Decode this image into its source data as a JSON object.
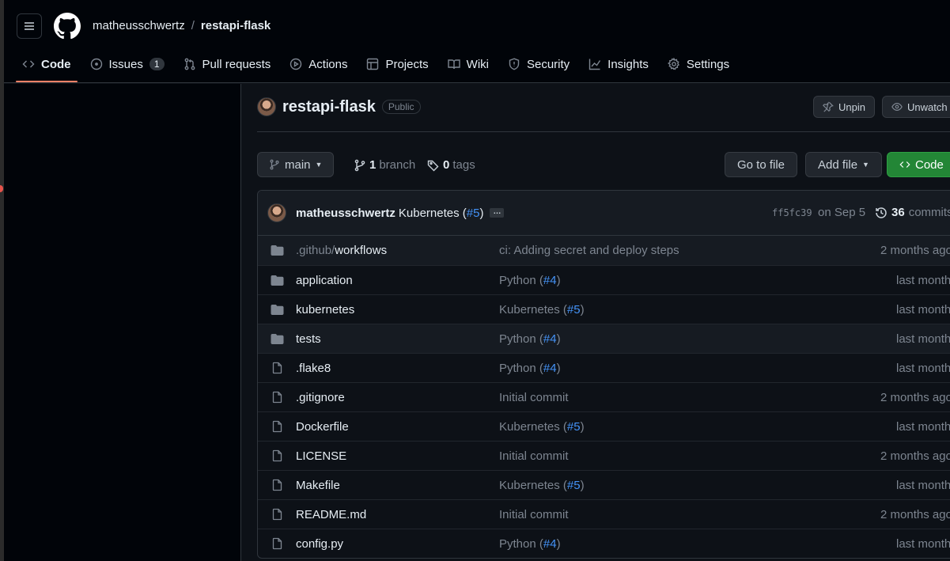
{
  "header": {
    "owner": "matheusschwertz",
    "separator": "/",
    "repo": "restapi-flask"
  },
  "tabs": [
    {
      "label": "Code",
      "icon": "code-icon",
      "active": true
    },
    {
      "label": "Issues",
      "icon": "issue-icon",
      "count": "1"
    },
    {
      "label": "Pull requests",
      "icon": "pull-request-icon"
    },
    {
      "label": "Actions",
      "icon": "play-icon"
    },
    {
      "label": "Projects",
      "icon": "table-icon"
    },
    {
      "label": "Wiki",
      "icon": "book-icon"
    },
    {
      "label": "Security",
      "icon": "shield-icon"
    },
    {
      "label": "Insights",
      "icon": "graph-icon"
    },
    {
      "label": "Settings",
      "icon": "gear-icon"
    }
  ],
  "repo": {
    "name": "restapi-flask",
    "visibility": "Public",
    "unpin_label": "Unpin",
    "unwatch_label": "Unwatch"
  },
  "toolbar": {
    "branch": "main",
    "branch_count": "1",
    "branch_word": "branch",
    "tag_count": "0",
    "tag_word": "tags",
    "goto_file": "Go to file",
    "add_file": "Add file",
    "code_button": "Code"
  },
  "commit": {
    "author": "matheusschwertz",
    "message": "Kubernetes (",
    "pr": "#5",
    "message_end": ")",
    "ellipsis": "…",
    "hash": "ff5fc39",
    "date": "on Sep 5",
    "count": "36",
    "count_label": "commits"
  },
  "files": [
    {
      "type": "folder",
      "name_prefix": ".github/",
      "name": "workflows",
      "msg": "ci: Adding secret and deploy steps",
      "pr": "",
      "msg_end": "",
      "age": "2 months ago"
    },
    {
      "type": "folder",
      "name_prefix": "",
      "name": "application",
      "msg": "Python (",
      "pr": "#4",
      "msg_end": ")",
      "age": "last month"
    },
    {
      "type": "folder",
      "name_prefix": "",
      "name": "kubernetes",
      "msg": "Kubernetes (",
      "pr": "#5",
      "msg_end": ")",
      "age": "last month"
    },
    {
      "type": "folder",
      "name_prefix": "",
      "name": "tests",
      "msg": "Python (",
      "pr": "#4",
      "msg_end": ")",
      "age": "last month"
    },
    {
      "type": "file",
      "name_prefix": "",
      "name": ".flake8",
      "msg": "Python (",
      "pr": "#4",
      "msg_end": ")",
      "age": "last month"
    },
    {
      "type": "file",
      "name_prefix": "",
      "name": ".gitignore",
      "msg": "Initial commit",
      "pr": "",
      "msg_end": "",
      "age": "2 months ago"
    },
    {
      "type": "file",
      "name_prefix": "",
      "name": "Dockerfile",
      "msg": "Kubernetes (",
      "pr": "#5",
      "msg_end": ")",
      "age": "last month"
    },
    {
      "type": "file",
      "name_prefix": "",
      "name": "LICENSE",
      "msg": "Initial commit",
      "pr": "",
      "msg_end": "",
      "age": "2 months ago"
    },
    {
      "type": "file",
      "name_prefix": "",
      "name": "Makefile",
      "msg": "Kubernetes (",
      "pr": "#5",
      "msg_end": ")",
      "age": "last month"
    },
    {
      "type": "file",
      "name_prefix": "",
      "name": "README.md",
      "msg": "Initial commit",
      "pr": "",
      "msg_end": "",
      "age": "2 months ago"
    },
    {
      "type": "file",
      "name_prefix": "",
      "name": "config.py",
      "msg": "Python (",
      "pr": "#4",
      "msg_end": ")",
      "age": "last month"
    }
  ]
}
